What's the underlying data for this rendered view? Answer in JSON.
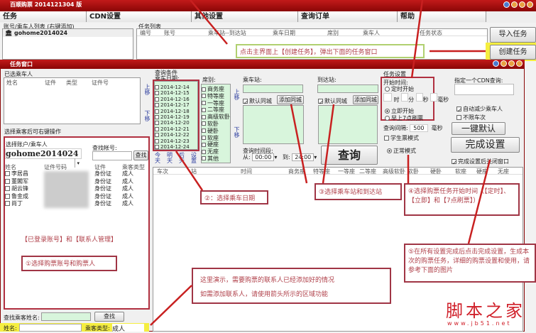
{
  "app": {
    "title": "百顺购票 2014121304 版"
  },
  "tabs": [
    "任务",
    "CDN设置",
    "其他设置",
    "查询订单",
    "帮助"
  ],
  "main": {
    "account_list_label": "账号/乘车人列表 (右键添加)",
    "accounts": [
      "gohome2014024"
    ],
    "task_list_label": "任务列表",
    "task_columns": [
      "编号",
      "账号",
      "乘车站--到达站",
      "乘车日期",
      "席别",
      "乘车人",
      "任务状态"
    ],
    "import_button": "导入任务",
    "create_button": "创建任务"
  },
  "task_window": {
    "title": "任务窗口",
    "selected_label": "已选乘车人",
    "selected_columns": [
      "姓名",
      "证件",
      "类型",
      "证件号"
    ],
    "move_up": "上移",
    "move_down": "下移",
    "hint": "选择乘客后可右键操作",
    "choose_label": "选择账户/乘车人",
    "account_value": "gohome2014024",
    "find_account_label": "查找帐号:",
    "find_button": "查找",
    "passenger_columns": [
      "姓名",
      "证件号码",
      "证件",
      "乘客类型"
    ],
    "passengers": [
      {
        "name": "李居昌",
        "doc": "身份证",
        "type": "成人"
      },
      {
        "name": "董閣军",
        "doc": "身份证",
        "type": "成人"
      },
      {
        "name": "胡云锋",
        "doc": "身份证",
        "type": "成人"
      },
      {
        "name": "鲁金成",
        "doc": "身份证",
        "type": "成人"
      },
      {
        "name": "尚丁",
        "doc": "身份证",
        "type": "成人"
      }
    ],
    "find_passenger_label": "查找乘客姓名:",
    "find_passenger_button": "查找",
    "name_label": "姓名:",
    "passenger_type_label": "乘客类型:",
    "passenger_type_value": "成人",
    "query_label": "查询条件",
    "date_label": "乘车日期:",
    "dates": [
      "2014-12-14",
      "2014-12-15",
      "2014-12-16",
      "2014-12-17",
      "2014-12-18",
      "2014-12-19",
      "2014-12-20",
      "2014-12-21",
      "2014-12-22",
      "2014-12-23",
      "2014-12-24"
    ],
    "date_buttons": [
      "今天",
      "明天",
      "后天",
      "设置"
    ],
    "seat_label": "席别:",
    "seats": [
      "商务座",
      "特等座",
      "一等座",
      "二等座",
      "高级软卧",
      "软卧",
      "硬卧",
      "软座",
      "硬座",
      "无座",
      "其他"
    ],
    "from_label": "乘车站:",
    "to_label": "到达站:",
    "default_city": "默认同城",
    "add_city": "添加同城",
    "time_range_label": "查询时间段:",
    "from_time_label": "从:",
    "from_time": "00:00",
    "to_time_label": "到:",
    "to_time": "24:00",
    "query_button": "查询",
    "result_columns": [
      "车次",
      "站",
      "时间",
      "商务座",
      "特等座",
      "一等座",
      "二等座",
      "高级软卧",
      "软卧",
      "硬卧",
      "软座",
      "硬座",
      "无座"
    ],
    "settings_label": "任务设置",
    "start_time_label": "开始时间:",
    "timed_start": "定时开始",
    "hour": "时",
    "minute": "分",
    "second": "秒",
    "ms": "毫秒",
    "immediate_start": "立即开始",
    "morning_refresh": "早上7点刷票",
    "interval_label": "查询间隔:",
    "interval_value": "500",
    "interval_unit": "毫秒",
    "student_mode": "学生票模式",
    "normal_mode": "正常模式",
    "cdn_label": "指定一个CDN查询:",
    "auto_reduce": "自动减少乘车人",
    "no_limit": "不限车次",
    "one_key_default": "一键默认",
    "finish_button": "完成设置",
    "close_after": "完成设置后关闭窗口"
  },
  "callouts": {
    "c0": "点击主界面上【创建任务】，弹出下面的任务窗口",
    "c1a": "【已登录账号】和【联系人管理】",
    "c1": "①选择购票账号和购票人",
    "c2": "②：选择乘车日期",
    "c3": "③选择乘车站和到达站",
    "c4": "④选择购票任务开始时间（【定时】、【立即】和【7点刷票】）",
    "c5": "⑤在所有设置完成后点击完成设置，生成本次的购票任务，详细的购票设置和使用，请参考下面的图片",
    "c6a": "这里演示，需要购票的联系人已经添加好的情况",
    "c6b": "如需添加联系人，请使用箭头所示的区域功能"
  },
  "watermark": {
    "logo": "脚本之家",
    "url": "www.jb51.net"
  },
  "colors": {
    "title_red": "#a30e0e",
    "callout": "#a03545",
    "green_list": "#d8f5dc"
  }
}
